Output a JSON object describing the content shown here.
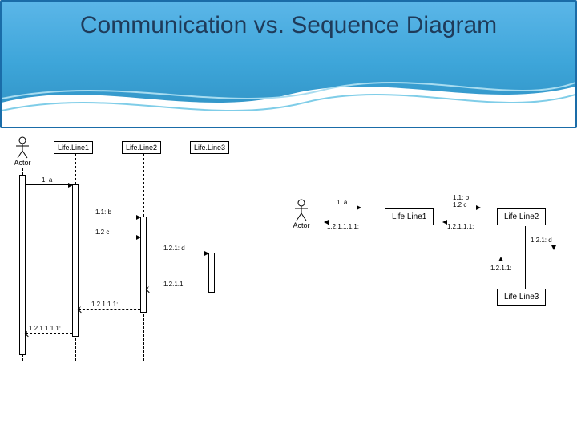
{
  "title": "Communication vs. Sequence Diagram",
  "sequence": {
    "actor_label": "Actor",
    "lifelines": [
      "Life.Line1",
      "Life.Line2",
      "Life.Line3"
    ],
    "messages": {
      "m1": "1: a",
      "m11": "1.1: b",
      "m12": "1.2 c",
      "m121": "1.2.1: d",
      "m1211": "1.2.1.1:",
      "m12111": "1.2.1.1.1:",
      "m121111": "1.2.1.1.1.1:"
    }
  },
  "communication": {
    "actor_label": "Actor",
    "nodes": [
      "Life.Line1",
      "Life.Line2",
      "Life.Line3"
    ],
    "messages": {
      "m1": "1: a",
      "m11_12": "1.1: b\n1.2 c",
      "m12111": "1.2.1.1.1:",
      "m121111": "1.2.1.1.1.1:",
      "m121": "1.2.1: d",
      "m1211": "1.2.1.1:"
    }
  }
}
